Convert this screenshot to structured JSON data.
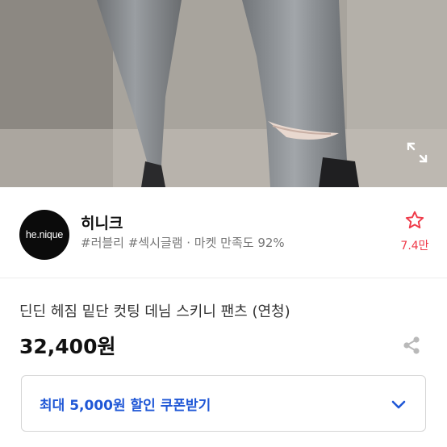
{
  "seller": {
    "logo_text": "he.nique",
    "name": "히니크",
    "meta": "#러블리 #섹시글램 · 마켓 만족도 92%",
    "favorite_count": "7.4만"
  },
  "product": {
    "title": "딘딘 헤짐 밑단 컷팅 데님 스키니 팬츠 (연청)",
    "price": "32,400원"
  },
  "coupon": {
    "label": "최대 5,000원 할인 쿠폰받기"
  },
  "colors": {
    "accent_blue": "#1f57d6",
    "favorite_red": "#ef3b4a"
  },
  "icons": [
    "expand-icon",
    "star-outline-icon",
    "share-icon",
    "chevron-down-icon"
  ]
}
